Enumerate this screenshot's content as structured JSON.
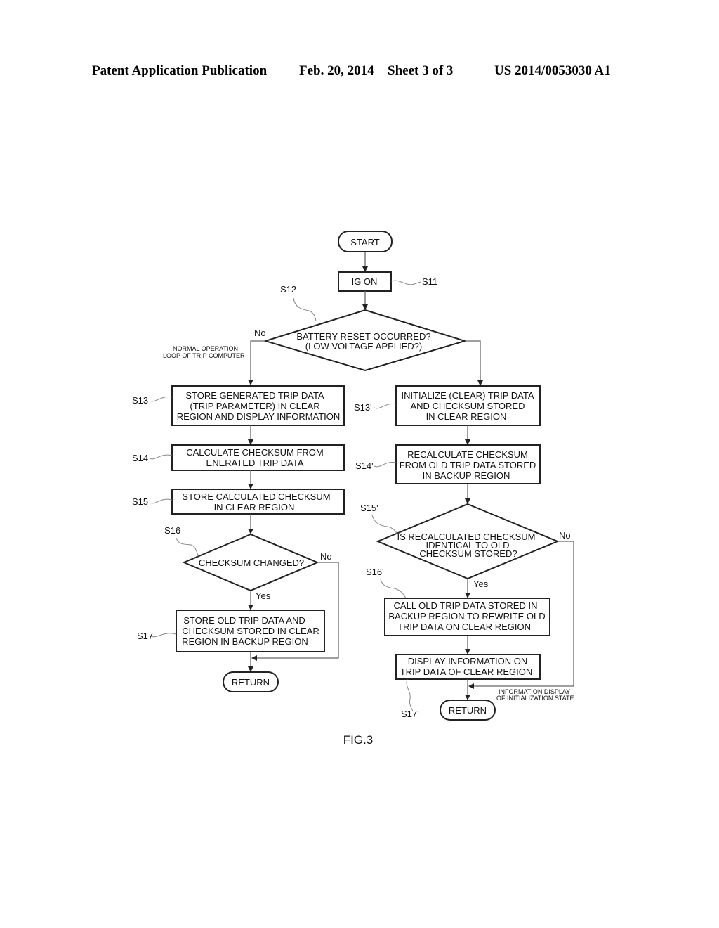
{
  "header": {
    "publication": "Patent Application Publication",
    "date": "Feb. 20, 2014",
    "sheet": "Sheet 3 of 3",
    "number": "US 2014/0053030 A1"
  },
  "flowchart": {
    "start": "START",
    "s11": {
      "id": "S11",
      "lines": [
        "IG ON"
      ]
    },
    "s12": {
      "id": "S12",
      "lines": [
        "BATTERY RESET OCCURRED?",
        "(LOW VOLTAGE APPLIED?)"
      ],
      "no_label": "No"
    },
    "normal_loop_note": [
      "NORMAL OPERATION",
      "LOOP OF TRIP COMPUTER"
    ],
    "left": {
      "s13": {
        "id": "S13",
        "lines": [
          "STORE GENERATED TRIP DATA",
          "(TRIP PARAMETER) IN CLEAR",
          "REGION AND DISPLAY INFORMATION"
        ]
      },
      "s14": {
        "id": "S14",
        "lines": [
          "CALCULATE CHECKSUM FROM",
          "ENERATED TRIP DATA"
        ]
      },
      "s15": {
        "id": "S15",
        "lines": [
          "STORE CALCULATED CHECKSUM",
          "IN CLEAR REGION"
        ]
      },
      "s16": {
        "id": "S16",
        "lines": [
          "CHECKSUM CHANGED?"
        ],
        "yes_label": "Yes",
        "no_label": "No"
      },
      "s17": {
        "id": "S17",
        "lines": [
          "STORE OLD TRIP DATA AND",
          "CHECKSUM STORED IN CLEAR",
          "REGION IN BACKUP REGION"
        ]
      },
      "return": "RETURN"
    },
    "right": {
      "s13p": {
        "id": "S13'",
        "lines": [
          "INITIALIZE (CLEAR) TRIP DATA",
          "AND CHECKSUM STORED",
          "IN CLEAR REGION"
        ]
      },
      "s14p": {
        "id": "S14'",
        "lines": [
          "RECALCULATE CHECKSUM",
          "FROM OLD TRIP DATA STORED",
          "IN BACKUP REGION"
        ]
      },
      "s15p": {
        "id": "S15'",
        "lines": [
          "IS RECALCULATED CHECKSUM",
          "IDENTICAL TO OLD",
          "CHECKSUM STORED?"
        ],
        "yes_label": "Yes",
        "no_label": "No"
      },
      "s16p": {
        "id": "S16'",
        "lines": [
          "CALL OLD TRIP DATA STORED IN",
          "BACKUP REGION TO REWRITE OLD",
          "TRIP DATA ON CLEAR REGION"
        ]
      },
      "s17p": {
        "id": "S17'",
        "lines": [
          "DISPLAY INFORMATION ON",
          "TRIP DATA OF CLEAR REGION"
        ]
      },
      "init_note": [
        "INFORMATION DISPLAY",
        "OF INITIALIZATION STATE"
      ],
      "return": "RETURN"
    }
  },
  "figure_label": "FIG.3"
}
